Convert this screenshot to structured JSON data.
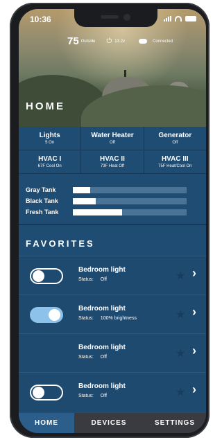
{
  "status_bar": {
    "time": "10:36"
  },
  "hero": {
    "outside_temp": "75",
    "outside_label": "Outside",
    "voltage": "13.2v",
    "connection": "Connected",
    "title": "HOME"
  },
  "systems": [
    {
      "name": "Lights",
      "status": "5 On"
    },
    {
      "name": "Water Heater",
      "status": "Off"
    },
    {
      "name": "Generator",
      "status": "Off"
    },
    {
      "name": "HVAC I",
      "status": "67F Cool On"
    },
    {
      "name": "HVAC II",
      "status": "73F Heat Off"
    },
    {
      "name": "HVAC III",
      "status": "75F Heat/Cool On"
    }
  ],
  "tanks": [
    {
      "label": "Gray Tank",
      "level": 0.15
    },
    {
      "label": "Black Tank",
      "level": 0.2
    },
    {
      "label": "Fresh Tank",
      "level": 0.43
    }
  ],
  "favorites_title": "FAVORITES",
  "favorites": [
    {
      "name": "Bedroom light",
      "status_label": "Status:",
      "status": "Off",
      "toggle": "off"
    },
    {
      "name": "Bedroom light",
      "status_label": "Status:",
      "status": "100% brightness",
      "toggle": "on"
    },
    {
      "name": "Bedroom light",
      "status_label": "Status:",
      "status": "Off",
      "toggle": "none"
    },
    {
      "name": "Bedroom light",
      "status_label": "Status:",
      "status": "Off",
      "toggle": "off"
    }
  ],
  "nav": {
    "home": "HOME",
    "devices": "DEVICES",
    "settings": "SETTINGS"
  },
  "colors": {
    "panel": "#1f4c73",
    "accent": "#2b5e8b",
    "toggle_on": "#8dc2ea"
  }
}
